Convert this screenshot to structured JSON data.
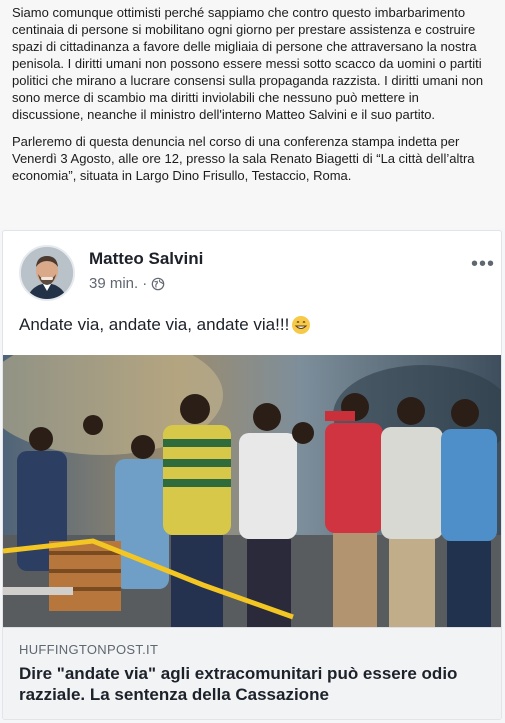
{
  "article": {
    "paragraphs": [
      "Siamo comunque ottimisti perché sappiamo che contro questo imbarbarimento centinaia di persone si mobilitano ogni giorno per prestare assistenza e costruire spazi di cittadinanza a favore delle migliaia di persone che attraversano la nostra penisola. I diritti umani non possono essere messi sotto scacco da uomini o partiti politici che mirano a lucrare consensi sulla propaganda razzista. I diritti umani non sono merce di scambio ma diritti inviolabili che nessuno può mettere in discussione, neanche il ministro dell'interno Matteo Salvini e il suo partito.",
      "Parleremo di questa denuncia nel corso di una conferenza stampa indetta per Venerdì 3 Agosto, alle ore 12, presso la sala Renato Biagetti di “La città dell’altra economia”, situata in Largo Dino Frisullo, Testaccio, Roma."
    ]
  },
  "post": {
    "author": "Matteo Salvini",
    "time": "39 min.",
    "separator": "·",
    "privacy_icon": "globe-icon",
    "more_icon": "more-options-icon",
    "more_label": "•••",
    "status_text": "Andate via, andate via, andate via!!!",
    "status_emoji": "grinning-face-icon",
    "photo": "crowd-photo",
    "link": {
      "domain": "HUFFINGTONPOST.IT",
      "title": "Dire \"andate via\" agli extracomunitari può essere odio razziale. La sentenza della Cassazione"
    }
  },
  "colors": {
    "page_bg": "#f7f7f7",
    "card_bg": "#ffffff",
    "link_bg": "#f2f3f5",
    "meta_text": "#616770",
    "tape": "#f3c623"
  }
}
